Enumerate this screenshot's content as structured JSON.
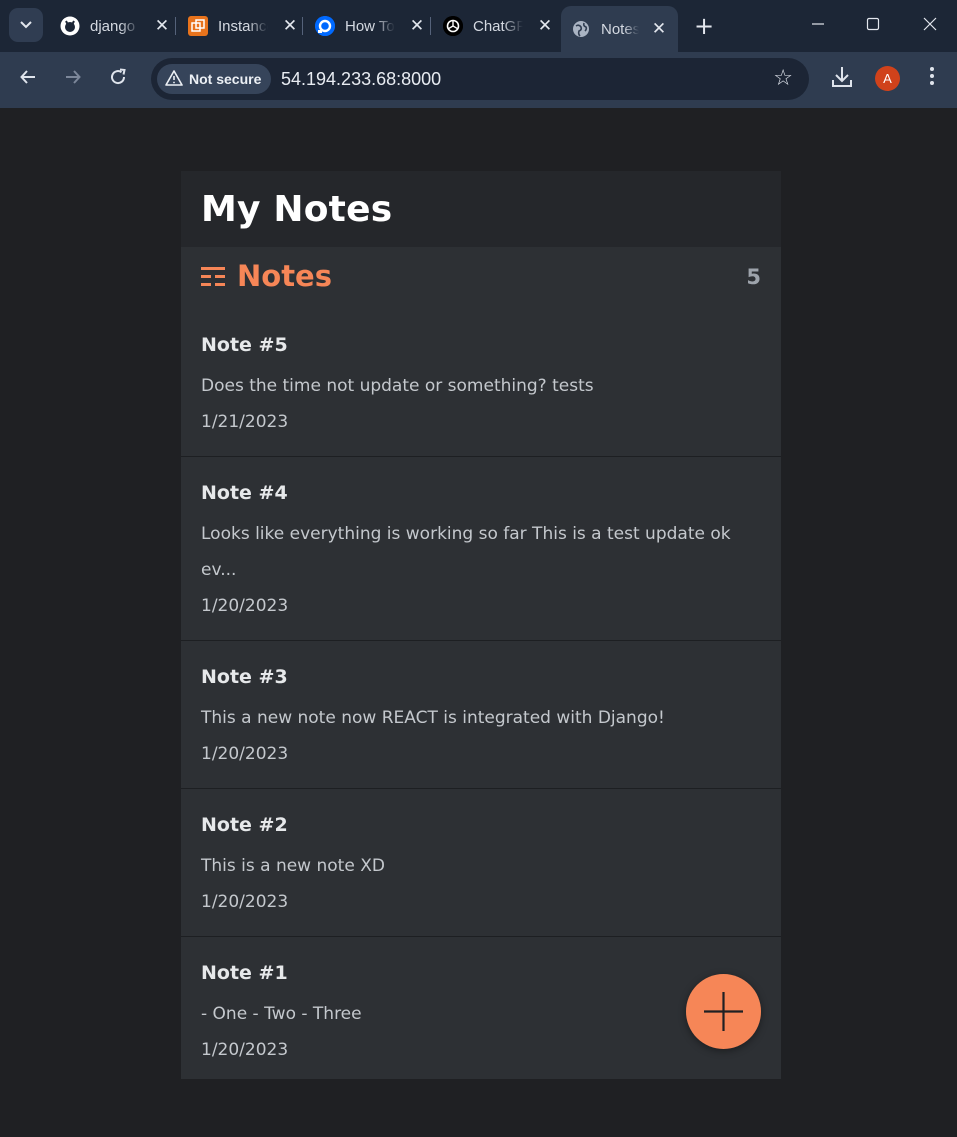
{
  "browser": {
    "tabs": [
      {
        "label": "django",
        "icon": "github-icon"
      },
      {
        "label": "Instances",
        "icon": "aws-instances-icon"
      },
      {
        "label": "How To",
        "icon": "digitalocean-icon"
      },
      {
        "label": "ChatGPT",
        "icon": "openai-icon"
      },
      {
        "label": "Notes",
        "icon": "globe-icon",
        "active": true
      }
    ],
    "security_label": "Not secure",
    "url": "54.194.233.68:8000",
    "profile_initial": "A"
  },
  "app": {
    "title": "My Notes",
    "section_title": "Notes",
    "count": "5",
    "accent": "#f68657",
    "notes": [
      {
        "title": "Note #5",
        "body": "Does the time not update or something? tests",
        "date": "1/21/2023"
      },
      {
        "title": "Note #4",
        "body": "Looks like everything is working so far This is a test update ok ev...",
        "date": "1/20/2023"
      },
      {
        "title": "Note #3",
        "body": "This a new note now REACT is integrated with Django!",
        "date": "1/20/2023"
      },
      {
        "title": "Note #2",
        "body": "This is a new note XD",
        "date": "1/20/2023"
      },
      {
        "title": "Note #1",
        "body": "- One - Two - Three",
        "date": "1/20/2023"
      }
    ]
  }
}
